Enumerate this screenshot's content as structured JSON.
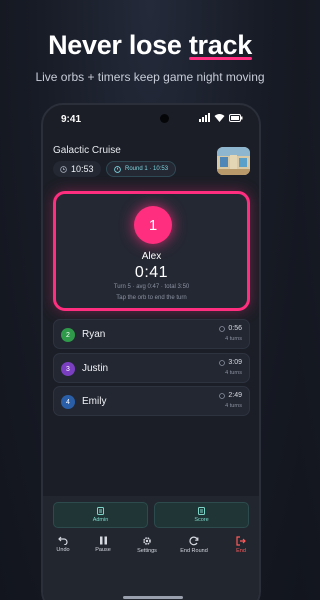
{
  "headline": {
    "prefix": "Never lose ",
    "highlight": "track"
  },
  "subline": "Live orbs + timers keep game night moving",
  "status": {
    "time": "9:41"
  },
  "game": {
    "title": "Galactic Cruise",
    "clock": "10:53",
    "round": "Round 1 · 10:53"
  },
  "active": {
    "orb_number": "1",
    "name": "Alex",
    "timer": "0:41",
    "meta": "Turn 5 · avg 0:47 · total 3:50",
    "hint": "Tap the orb to end the turn",
    "accent": "#ff2e7e"
  },
  "players": [
    {
      "number": "2",
      "name": "Ryan",
      "time": "0:56",
      "turns": "4 turns",
      "color": "#2e9a4a"
    },
    {
      "number": "3",
      "name": "Justin",
      "time": "3:09",
      "turns": "4 turns",
      "color": "#7a3fc0"
    },
    {
      "number": "4",
      "name": "Emily",
      "time": "2:49",
      "turns": "4 turns",
      "color": "#2a5fa8"
    }
  ],
  "panel": {
    "admin": "Admin",
    "score": "Score"
  },
  "toolbar": {
    "undo": "Undo",
    "pause": "Pause",
    "settings": "Settings",
    "end_round": "End Round",
    "end": "End"
  },
  "icons": [
    "signal-icon",
    "wifi-icon",
    "battery-icon",
    "clock-icon",
    "timer-icon",
    "undo-icon",
    "pause-icon",
    "gear-icon",
    "refresh-icon",
    "exit-icon",
    "document-icon"
  ]
}
